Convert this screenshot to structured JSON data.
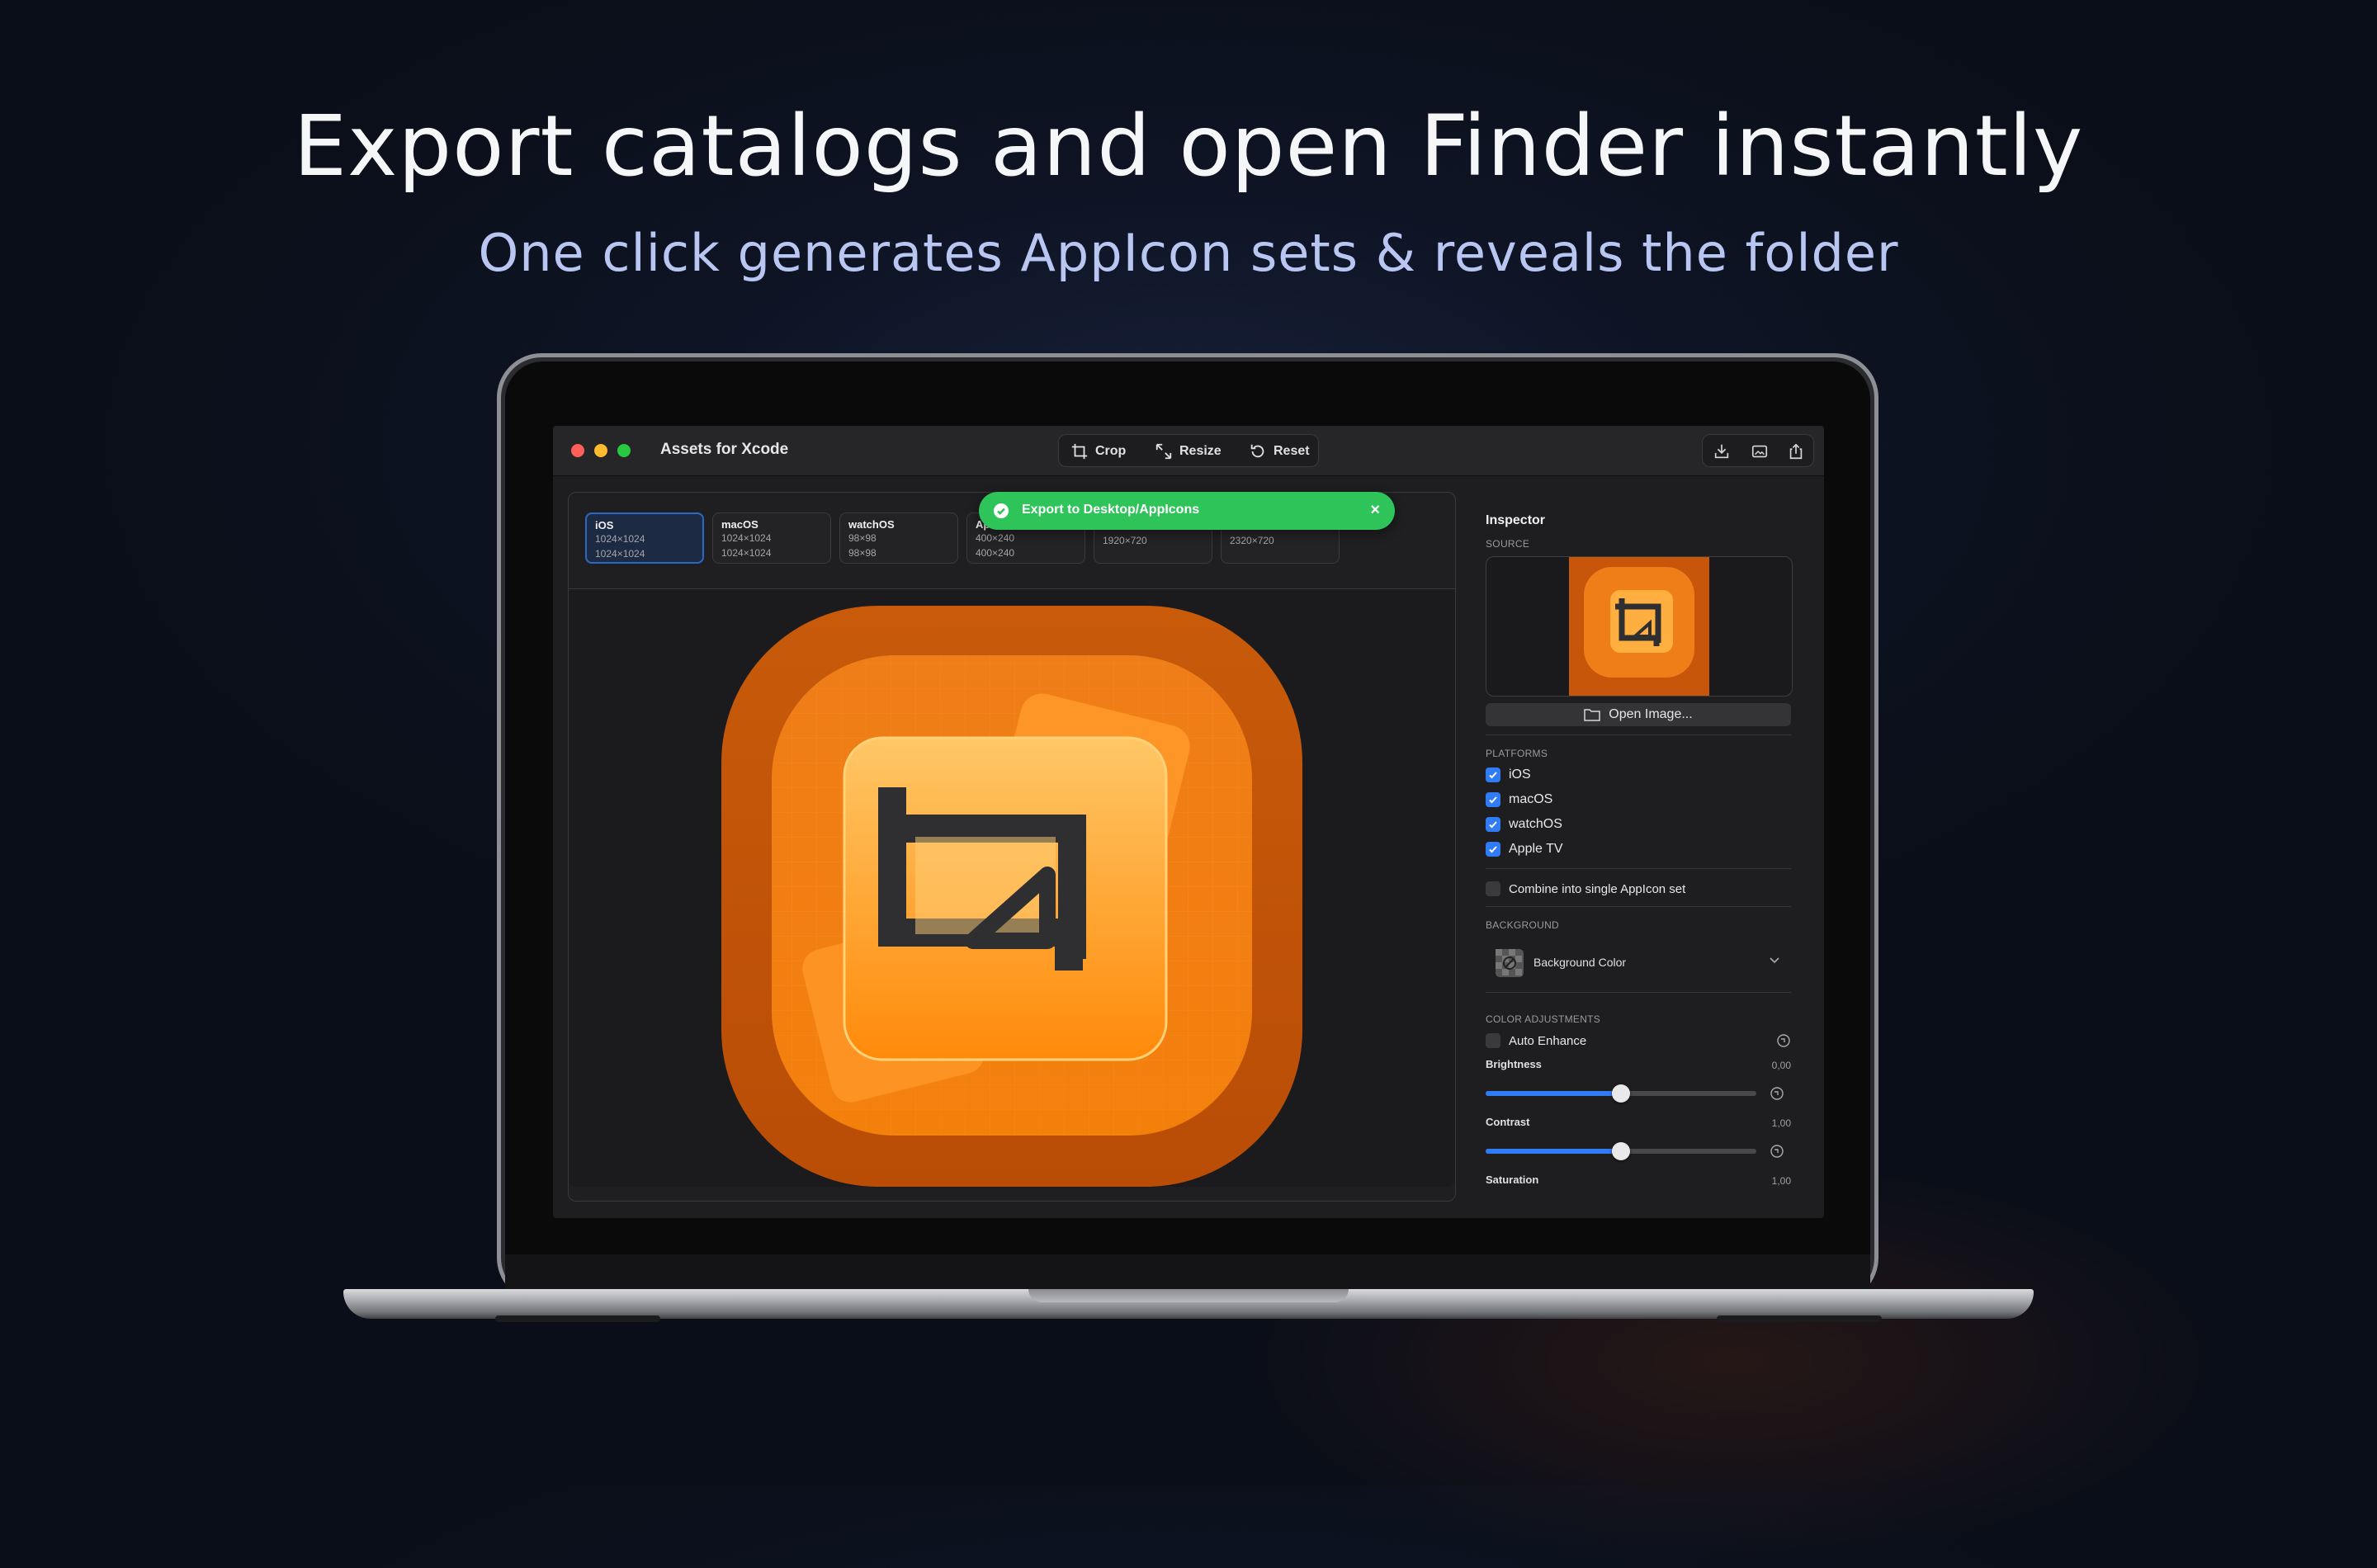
{
  "headline": "Export catalogs and open Finder instantly",
  "subheadline": "One click generates AppIcon sets & reveals the folder",
  "window": {
    "title": "Assets for Xcode",
    "toolbar": {
      "crop": "Crop",
      "resize": "Resize",
      "reset": "Reset"
    },
    "right_tools": [
      "import-icon",
      "gallery-icon",
      "share-icon"
    ]
  },
  "toast": {
    "message": "Export to Desktop/AppIcons",
    "close": "×"
  },
  "platform_cards": [
    {
      "name": "iOS",
      "line1": "1024×1024",
      "line2": "1024×1024",
      "selected": true
    },
    {
      "name": "macOS",
      "line1": "1024×1024",
      "line2": "1024×1024",
      "selected": false
    },
    {
      "name": "watchOS",
      "line1": "98×98",
      "line2": "98×98",
      "selected": false
    },
    {
      "name": "Ap",
      "line1": "400×240",
      "line2": "400×240",
      "selected": false
    },
    {
      "name": "",
      "line1": "1920×720",
      "line2": "1920×720",
      "selected": false
    },
    {
      "name": "",
      "line1": "2320×720",
      "line2": "2320×720",
      "selected": false
    }
  ],
  "inspector": {
    "title": "Inspector",
    "source_label": "SOURCE",
    "open_image": "Open Image...",
    "platforms_label": "PLATFORMS",
    "platforms": [
      {
        "label": "iOS",
        "checked": true
      },
      {
        "label": "macOS",
        "checked": true
      },
      {
        "label": "watchOS",
        "checked": true
      },
      {
        "label": "Apple TV",
        "checked": true
      }
    ],
    "combine_label": "Combine into single AppIcon set",
    "background_label": "BACKGROUND",
    "background_select": "Background Color",
    "color_adjustments_label": "COLOR ADJUSTMENTS",
    "auto_enhance": "Auto Enhance",
    "brightness": {
      "label": "Brightness",
      "value": "0,00",
      "level": 0.5
    },
    "contrast": {
      "label": "Contrast",
      "value": "1,00",
      "level": 0.5
    },
    "saturation": {
      "label": "Saturation",
      "value": "1,00"
    }
  },
  "colors": {
    "accent": "#2f7cf6",
    "toast": "#2ec45a",
    "icon_orange": "#f07a0c"
  }
}
